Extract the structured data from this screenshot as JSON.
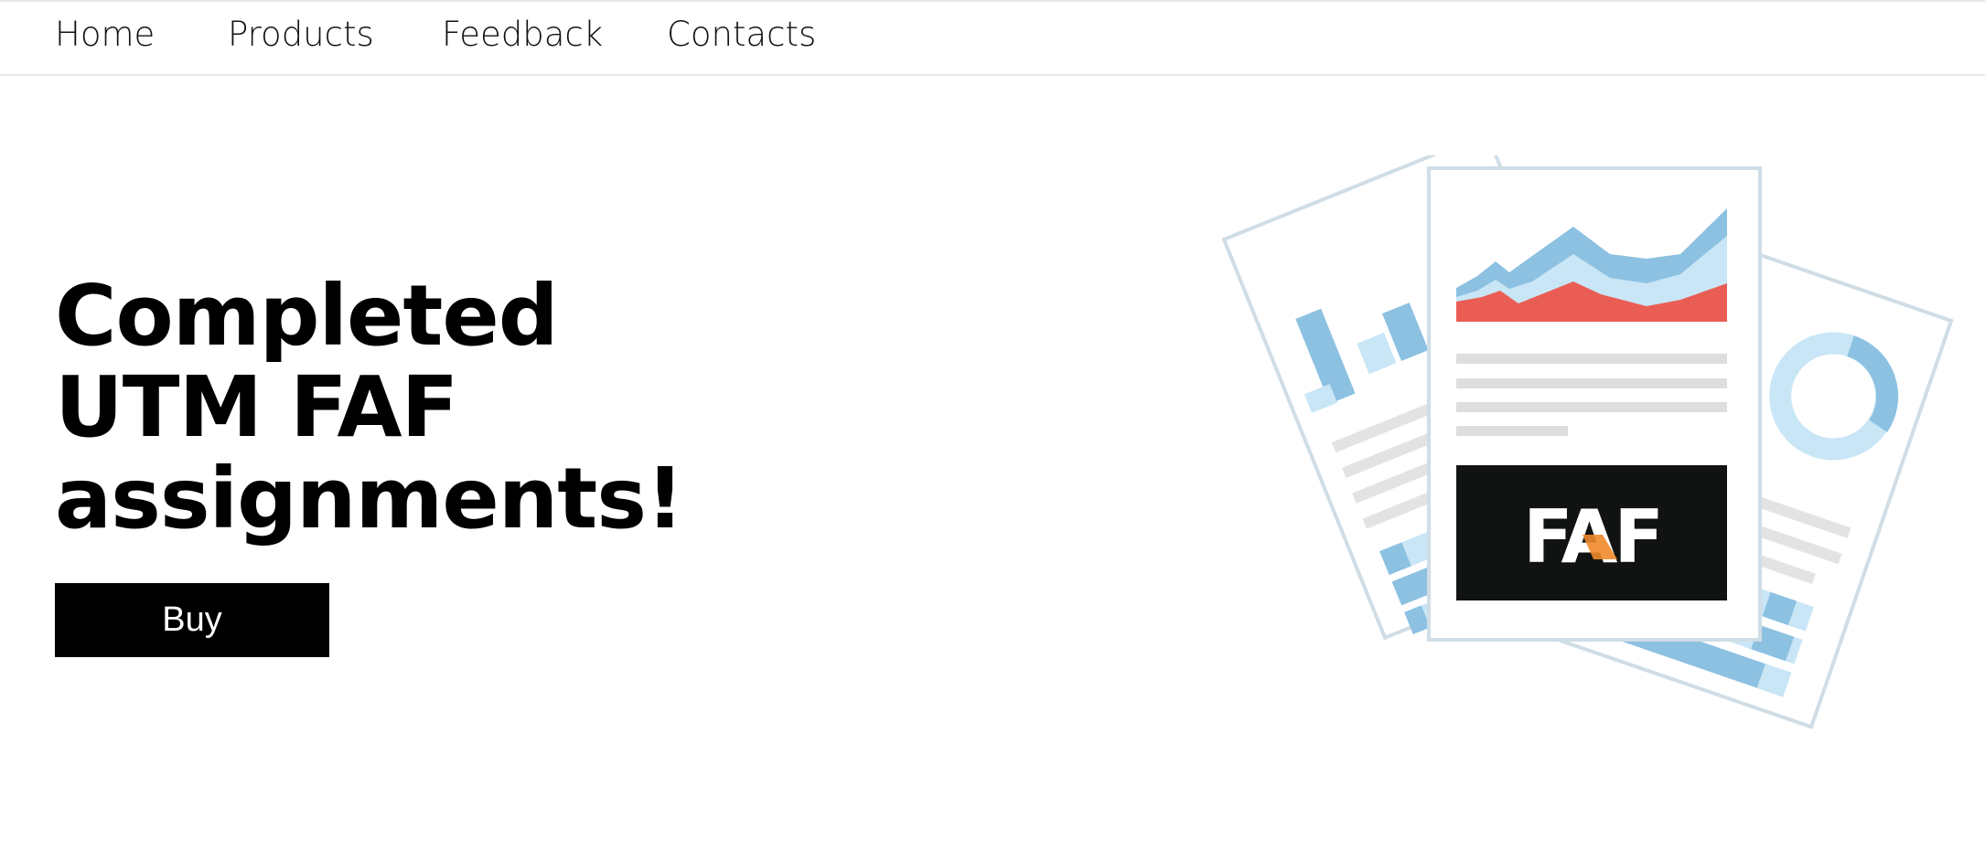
{
  "nav": {
    "items": [
      {
        "label": "Home"
      },
      {
        "label": "Products"
      },
      {
        "label": "Feedback"
      },
      {
        "label": "Contacts"
      }
    ]
  },
  "hero": {
    "title_lines": [
      "Completed",
      "UTM FAF",
      "assignments!"
    ],
    "buy_label": "Buy"
  },
  "illustration": {
    "logo_text": "FAF",
    "colors": {
      "paper_border": "#cfdde6",
      "light_blue": "#c9e6f6",
      "mid_blue": "#8cc1e2",
      "red": "#ea5d55",
      "gray_line": "#dedede",
      "logo_bg": "#111312",
      "logo_accent": "#f08a2c"
    }
  }
}
